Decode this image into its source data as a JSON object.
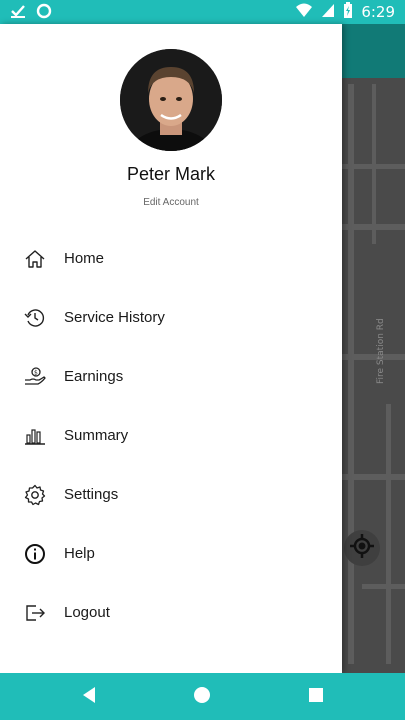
{
  "status_bar": {
    "time": "6:29",
    "left_icons": [
      "checkmark-icon",
      "circle-icon"
    ],
    "right_icons": [
      "wifi-icon",
      "signal-icon",
      "battery-icon"
    ],
    "bg_color": "#20BDB8"
  },
  "profile": {
    "name": "Peter Mark",
    "edit_label": "Edit Account"
  },
  "menu": {
    "items": [
      {
        "label": "Home",
        "icon": "home-icon"
      },
      {
        "label": "Service History",
        "icon": "history-icon"
      },
      {
        "label": "Earnings",
        "icon": "earnings-icon"
      },
      {
        "label": "Summary",
        "icon": "bar-chart-icon"
      },
      {
        "label": "Settings",
        "icon": "gear-icon"
      },
      {
        "label": "Help",
        "icon": "info-icon"
      },
      {
        "label": "Logout",
        "icon": "logout-icon"
      }
    ]
  },
  "map": {
    "road_label": "Fire Station Rd"
  },
  "nav_bar": {
    "buttons": [
      "back-icon",
      "home-circle-icon",
      "recents-icon"
    ]
  }
}
